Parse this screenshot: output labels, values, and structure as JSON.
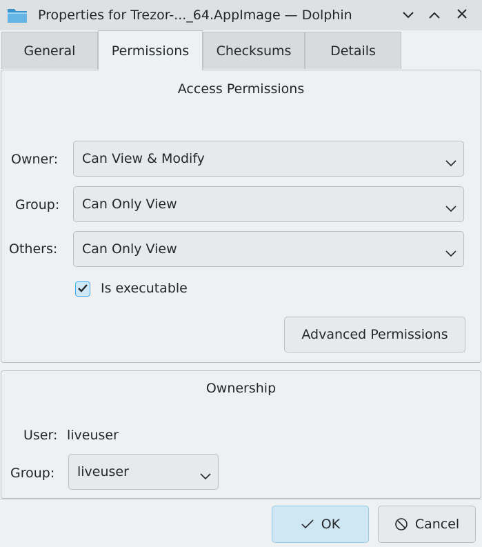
{
  "window": {
    "title": "Properties for Trezor-..._64.AppImage — Dolphin"
  },
  "tabs": [
    {
      "label": "General",
      "active": false
    },
    {
      "label": "Permissions",
      "active": true
    },
    {
      "label": "Checksums",
      "active": false
    },
    {
      "label": "Details",
      "active": false
    }
  ],
  "access": {
    "title": "Access Permissions",
    "owner_label": "Owner:",
    "owner_value": "Can View & Modify",
    "group_label": "Group:",
    "group_value": "Can Only View",
    "others_label": "Others:",
    "others_value": "Can Only View",
    "executable_label": "Is executable",
    "executable_checked": true,
    "advanced_button": "Advanced Permissions"
  },
  "ownership": {
    "title": "Ownership",
    "user_label": "User:",
    "user_value": "liveuser",
    "group_label": "Group:",
    "group_value": "liveuser"
  },
  "footer": {
    "ok_label": "OK",
    "cancel_label": "Cancel"
  },
  "icons": {
    "app": "folder-icon",
    "minimize": "chevron-down-icon",
    "maximize": "chevron-up-icon",
    "close": "close-icon",
    "ok": "check-icon",
    "cancel": "cancel-icon"
  },
  "colors": {
    "accent": "#3daee9",
    "background": "#eff0f1",
    "titlebar": "#dee0e2"
  }
}
